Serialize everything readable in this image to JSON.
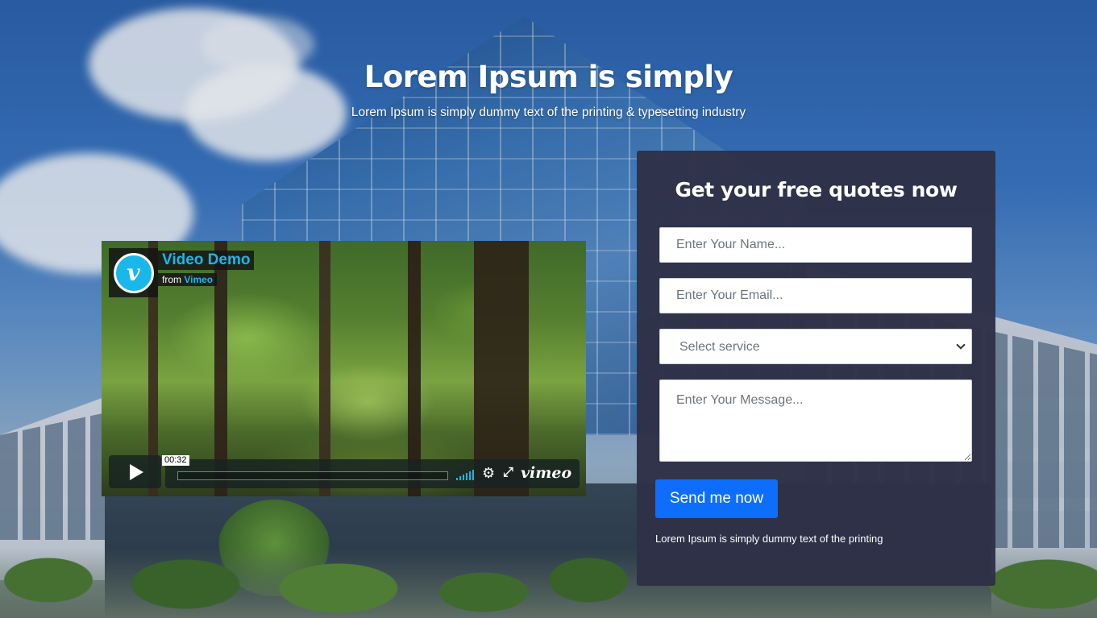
{
  "hero": {
    "title": "Lorem Ipsum is simply",
    "subtitle": "Lorem Ipsum is simply dummy text of the printing & typesetting industry"
  },
  "video": {
    "title": "Video Demo",
    "from_prefix": "from",
    "from_source": "Vimeo",
    "timecode": "00:32",
    "brand": "vimeo",
    "logo_letter": "v",
    "icons": [
      "vimeo-logo-icon",
      "play-icon",
      "volume-icon",
      "gear-icon",
      "fullscreen-icon"
    ],
    "accent_color": "#1ab7ea"
  },
  "form": {
    "heading": "Get your free quotes now",
    "name_placeholder": "Enter Your Name...",
    "email_placeholder": "Enter Your Email...",
    "service_selected": "Select service",
    "message_placeholder": "Enter Your Message...",
    "submit_label": "Send me now",
    "note": "Lorem Ipsum is simply dummy text of the printing",
    "card_color": "#2e3147",
    "button_color": "#0d6efd"
  }
}
